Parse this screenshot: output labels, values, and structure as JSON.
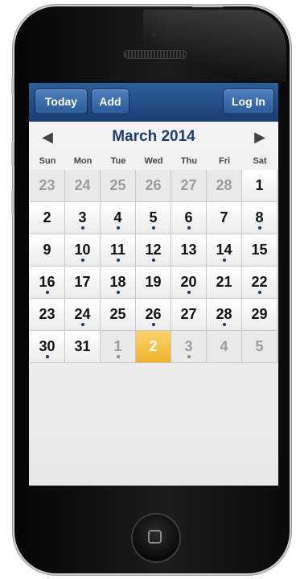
{
  "toolbar": {
    "today_label": "Today",
    "add_label": "Add",
    "login_label": "Log In"
  },
  "calendar": {
    "month_title": "March 2014",
    "prev_icon": "◀",
    "next_icon": "▶",
    "weekdays": [
      "Sun",
      "Mon",
      "Tue",
      "Wed",
      "Thu",
      "Fri",
      "Sat"
    ],
    "weeks": [
      [
        {
          "d": "23",
          "o": true,
          "e": false
        },
        {
          "d": "24",
          "o": true,
          "e": false
        },
        {
          "d": "25",
          "o": true,
          "e": false
        },
        {
          "d": "26",
          "o": true,
          "e": false
        },
        {
          "d": "27",
          "o": true,
          "e": false
        },
        {
          "d": "28",
          "o": true,
          "e": false
        },
        {
          "d": "1",
          "o": false,
          "e": false
        }
      ],
      [
        {
          "d": "2",
          "o": false,
          "e": false
        },
        {
          "d": "3",
          "o": false,
          "e": true
        },
        {
          "d": "4",
          "o": false,
          "e": true
        },
        {
          "d": "5",
          "o": false,
          "e": true
        },
        {
          "d": "6",
          "o": false,
          "e": true
        },
        {
          "d": "7",
          "o": false,
          "e": false
        },
        {
          "d": "8",
          "o": false,
          "e": true
        }
      ],
      [
        {
          "d": "9",
          "o": false,
          "e": false
        },
        {
          "d": "10",
          "o": false,
          "e": true
        },
        {
          "d": "11",
          "o": false,
          "e": true
        },
        {
          "d": "12",
          "o": false,
          "e": true
        },
        {
          "d": "13",
          "o": false,
          "e": false
        },
        {
          "d": "14",
          "o": false,
          "e": true
        },
        {
          "d": "15",
          "o": false,
          "e": false
        }
      ],
      [
        {
          "d": "16",
          "o": false,
          "e": true
        },
        {
          "d": "17",
          "o": false,
          "e": false
        },
        {
          "d": "18",
          "o": false,
          "e": true
        },
        {
          "d": "19",
          "o": false,
          "e": false
        },
        {
          "d": "20",
          "o": false,
          "e": true
        },
        {
          "d": "21",
          "o": false,
          "e": false
        },
        {
          "d": "22",
          "o": false,
          "e": true
        }
      ],
      [
        {
          "d": "23",
          "o": false,
          "e": false
        },
        {
          "d": "24",
          "o": false,
          "e": true
        },
        {
          "d": "25",
          "o": false,
          "e": false
        },
        {
          "d": "26",
          "o": false,
          "e": true
        },
        {
          "d": "27",
          "o": false,
          "e": false
        },
        {
          "d": "28",
          "o": false,
          "e": true
        },
        {
          "d": "29",
          "o": false,
          "e": false
        }
      ],
      [
        {
          "d": "30",
          "o": false,
          "e": true
        },
        {
          "d": "31",
          "o": false,
          "e": false
        },
        {
          "d": "1",
          "o": true,
          "e": true
        },
        {
          "d": "2",
          "o": true,
          "e": false,
          "t": true
        },
        {
          "d": "3",
          "o": true,
          "e": true
        },
        {
          "d": "4",
          "o": true,
          "e": false
        },
        {
          "d": "5",
          "o": true,
          "e": false
        }
      ]
    ]
  },
  "colors": {
    "toolbar": "#1f4a82",
    "month_title": "#1c3c73",
    "today_highlight": "#f2bd3f"
  }
}
